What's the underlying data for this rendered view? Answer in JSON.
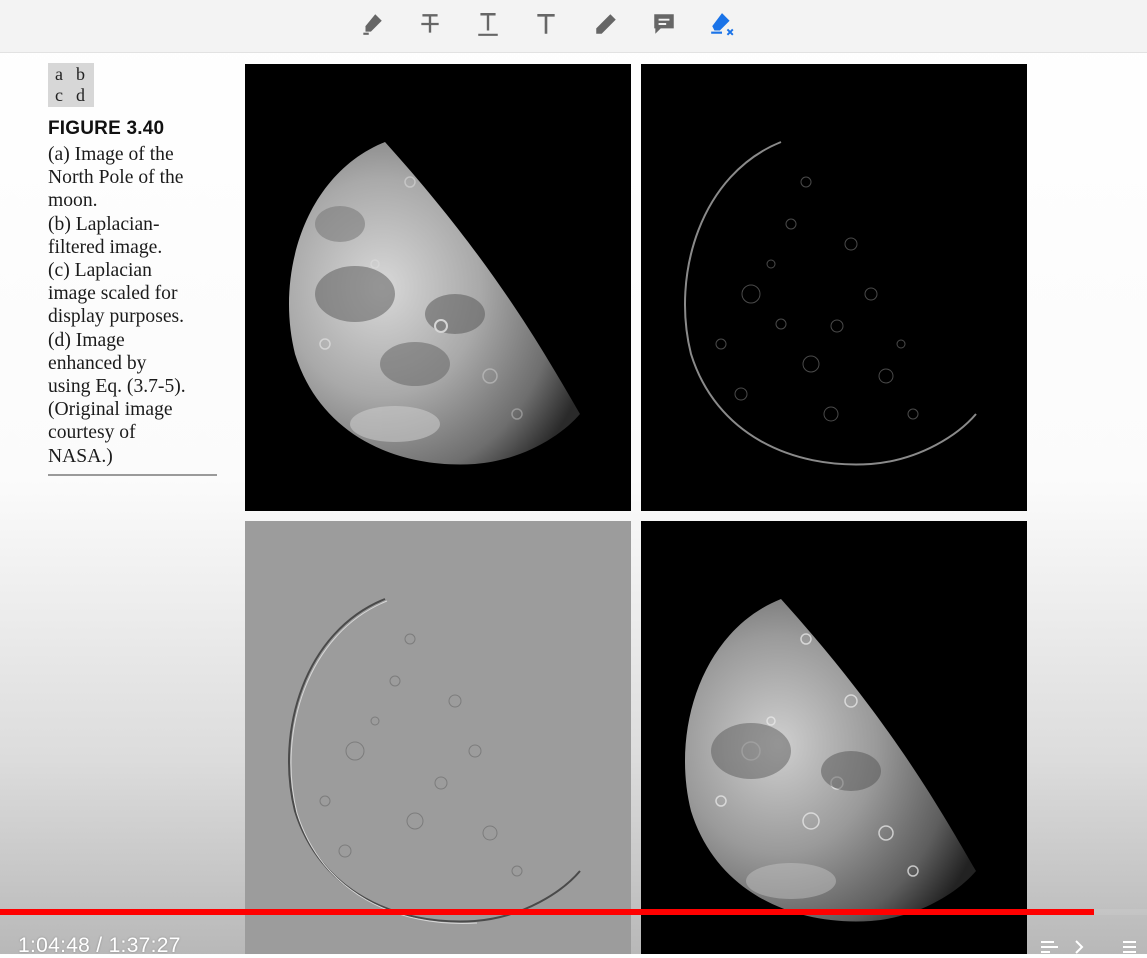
{
  "toolbar": {
    "tools": [
      {
        "name": "highlight-pen-icon"
      },
      {
        "name": "strikethrough-text-icon"
      },
      {
        "name": "underline-text-icon"
      },
      {
        "name": "text-icon"
      },
      {
        "name": "pencil-icon"
      },
      {
        "name": "comment-icon"
      },
      {
        "name": "eraser-icon"
      }
    ],
    "accent_color": "#1a73e8"
  },
  "figure": {
    "panel_labels": [
      "a",
      "b",
      "c",
      "d"
    ],
    "title": "FIGURE 3.40",
    "caption_lines": [
      "(a) Image of the",
      "North Pole of the",
      "moon.",
      "(b) Laplacian-",
      "filtered image.",
      "(c) Laplacian",
      "image scaled for",
      "display purposes.",
      "(d) Image",
      "enhanced by",
      "using Eq. (3.7-5).",
      "(Original image",
      "courtesy of",
      "NASA.)"
    ],
    "images": [
      {
        "id": "a",
        "desc": "moon-original"
      },
      {
        "id": "b",
        "desc": "moon-laplacian-filtered"
      },
      {
        "id": "c",
        "desc": "moon-laplacian-scaled"
      },
      {
        "id": "d",
        "desc": "moon-enhanced"
      }
    ]
  },
  "player": {
    "current_time": "1:04:48",
    "separator": " / ",
    "duration": "1:37:27",
    "progress_fraction": 0.954,
    "progress_color": "#ff0000"
  }
}
